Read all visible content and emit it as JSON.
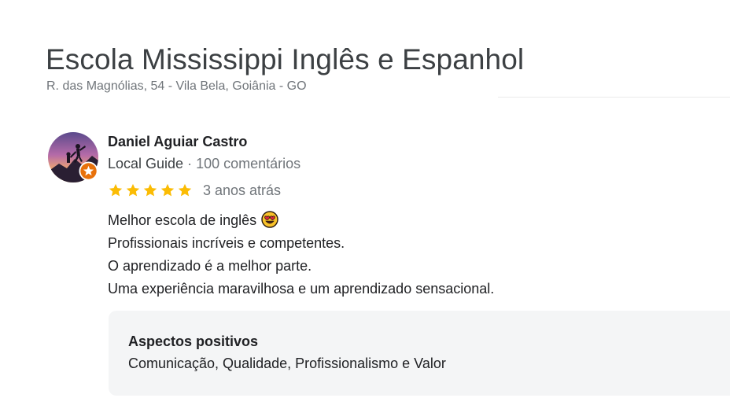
{
  "place": {
    "title": "Escola Mississippi Inglês e Espanhol",
    "address": "R. das Magnólias, 54 - Vila Bela, Goiânia - GO"
  },
  "review": {
    "reviewer": {
      "name": "Daniel Aguiar Castro",
      "badge": "Local Guide",
      "separator": "·",
      "review_count": "100 comentários",
      "avatar_icon": "climber-silhouette-avatar",
      "badge_icon": "local-guide-star-icon"
    },
    "rating": {
      "stars": 5,
      "max": 5,
      "color": "#fbbc04",
      "date": "3 anos atrás"
    },
    "lines": [
      "Melhor escola de inglês",
      "Profissionais incríveis e competentes.",
      "O aprendizado é a melhor parte.",
      "Uma experiência maravilhosa e um aprendizado sensacional."
    ],
    "emoji": "heart-eyes-emoji",
    "aspects": {
      "title": "Aspectos positivos",
      "values": "Comunicação, Qualidade, Profissionalismo e Valor"
    }
  },
  "colors": {
    "title": "#3c4043",
    "secondary_text": "#70757a",
    "star": "#fbbc04",
    "badge": "#e8710a",
    "aspects_background": "#f4f5f6"
  }
}
